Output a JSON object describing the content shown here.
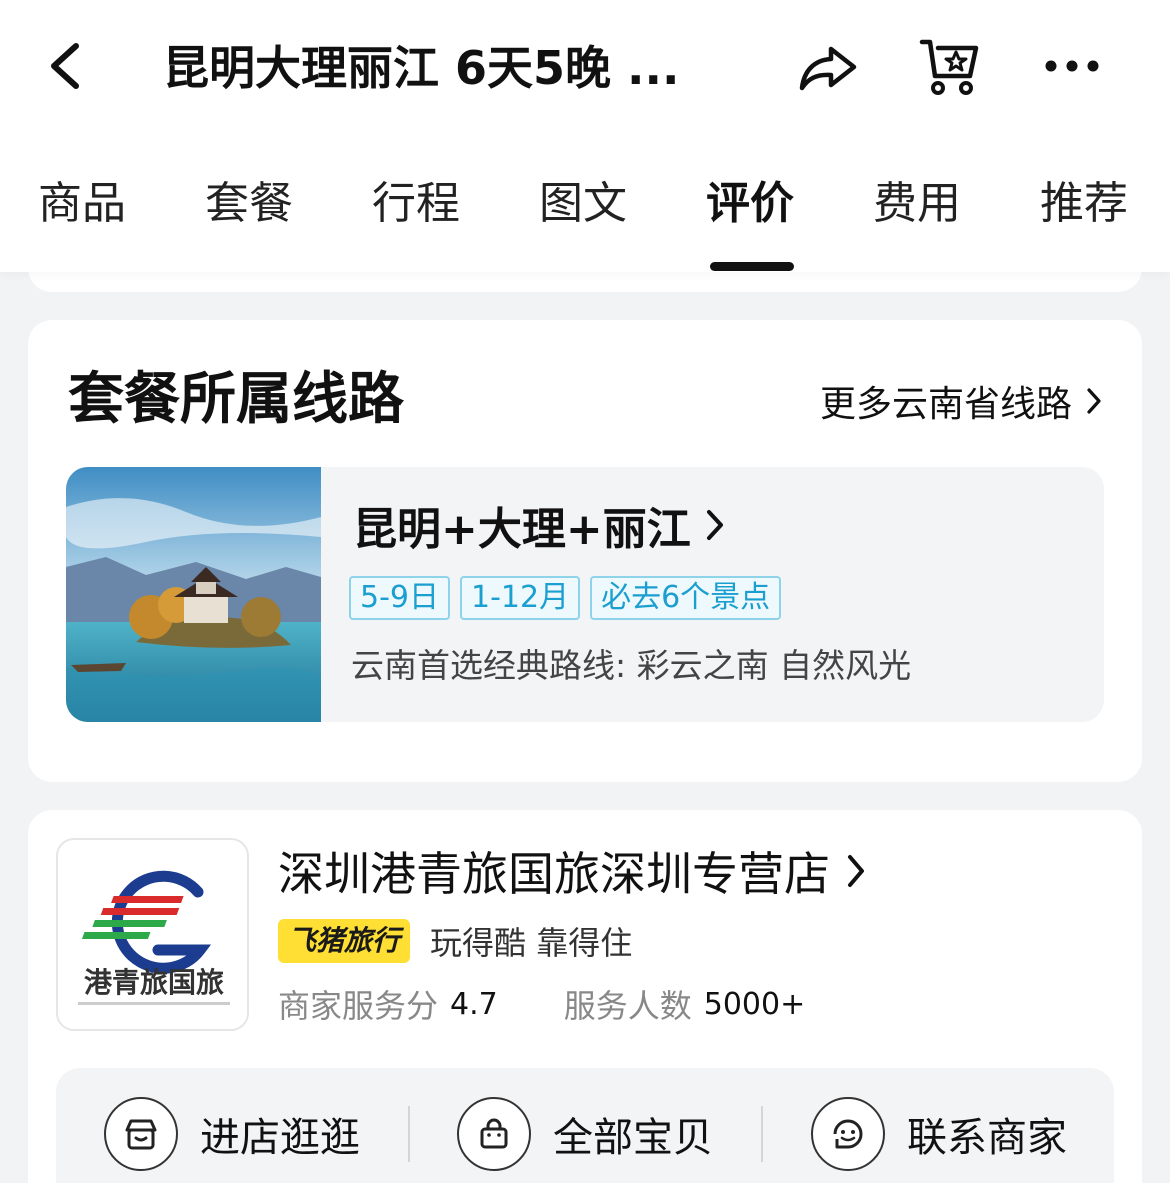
{
  "header": {
    "title": "昆明大理丽江 6天5晚 ...",
    "icons": {
      "back": "back-arrow-icon",
      "share": "share-icon",
      "cart": "shopping-cart-icon",
      "more": "more-dots-icon"
    }
  },
  "tabs": [
    {
      "label": "商品"
    },
    {
      "label": "套餐"
    },
    {
      "label": "行程"
    },
    {
      "label": "图文"
    },
    {
      "label": "评价",
      "active": true
    },
    {
      "label": "费用"
    },
    {
      "label": "推荐"
    }
  ],
  "route_section": {
    "heading": "套餐所属线路",
    "more_link": "更多云南省线路",
    "route": {
      "name": "昆明+大理+丽江",
      "tags": [
        "5-9日",
        "1-12月",
        "必去6个景点"
      ],
      "description": "云南首选经典路线: 彩云之南 自然风光"
    }
  },
  "store": {
    "name": "深圳港青旅国旅深圳专营店",
    "logo_text": "港青旅国旅",
    "badge": "飞猪旅行",
    "slogan": "玩得酷 靠得住",
    "service_score_label": "商家服务分",
    "service_score": "4.7",
    "served_label": "服务人数",
    "served_count": "5000+",
    "actions": [
      {
        "label": "进店逛逛",
        "icon": "store-icon"
      },
      {
        "label": "全部宝贝",
        "icon": "bag-icon"
      },
      {
        "label": "联系商家",
        "icon": "chat-face-icon"
      }
    ]
  },
  "colors": {
    "accent_tag": "#1a9fd0",
    "badge_yellow": "#ffdf33",
    "background": "#f2f3f5"
  }
}
